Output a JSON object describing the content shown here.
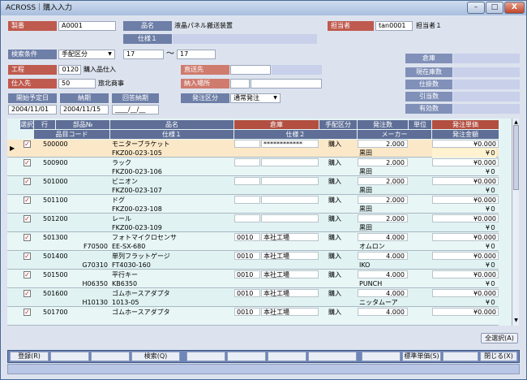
{
  "window": {
    "title": "ACROSS｜購入入力",
    "min": "–",
    "max": "□",
    "close": "X"
  },
  "header": {
    "seiban_label": "製番",
    "seiban_value": "A0001",
    "hinmei_label": "品名",
    "hinmei_value": "液晶パネル搬送装置",
    "shiyo1_label": "仕様１",
    "tanto_label": "担当者",
    "tanto_code": "tan0001",
    "tanto_name": "担当者１",
    "kensaku_label": "検索条件",
    "kensaku_value": "手配区分",
    "range_from": "17",
    "range_sep": "～",
    "range_to": "17",
    "souko_label": "倉庫",
    "koutei_label": "工程",
    "koutei_code": "0120",
    "koutei_name": "購入品仕入",
    "chokusou_label": "直送先",
    "genzaiko_label": "現在庫数",
    "shiiresaki_label": "仕入先",
    "shiiresaki_code": "50",
    "shiiresaki_name": "旅北商事",
    "nounyu_label": "納入場所",
    "shiharai_label": "仕掛数",
    "start_label": "開始予定日",
    "start_value": "2004/11/01",
    "nouki_label": "納期",
    "nouki_value": "2004/11/15",
    "kaito_label": "回答納期",
    "kaito_value": "____/__/__",
    "hatchu_label": "発注区分",
    "hatchu_value": "通常発注",
    "hikiate_label": "引当数",
    "yuko_label": "有効数"
  },
  "grid": {
    "headers1": {
      "sentaku": "選択",
      "gyo": "行",
      "buhin": "部品№",
      "hinmei": "品名",
      "souko": "倉庫",
      "tehai": "手配区分",
      "hatchusu": "発注数",
      "tani": "単位",
      "tanka": "発注単価"
    },
    "headers2": {
      "code": "品目コード",
      "shiyo1": "仕様１",
      "shiyo2": "仕様２",
      "maker": "メーカー",
      "kingaku": "発注金額"
    },
    "rows": [
      {
        "code": "500000",
        "name": "モニターブラケット",
        "spec1": "FKZ00-023-105",
        "wh_code": "",
        "wh_name": "************",
        "kubun": "購入",
        "qty": "2.000",
        "maker": "黒田",
        "price": "¥0.000",
        "amount": "¥０",
        "checked": "✓",
        "part": "",
        "current": true
      },
      {
        "code": "500900",
        "name": "ラック",
        "spec1": "FKZ00-023-106",
        "wh_code": "",
        "wh_name": "",
        "kubun": "購入",
        "qty": "2.000",
        "maker": "黒田",
        "price": "¥0.000",
        "amount": "¥０",
        "checked": "✓",
        "part": ""
      },
      {
        "code": "501000",
        "name": "ビニオン",
        "spec1": "FKZ00-023-107",
        "wh_code": "",
        "wh_name": "",
        "kubun": "購入",
        "qty": "2.000",
        "maker": "黒田",
        "price": "¥0.000",
        "amount": "¥０",
        "checked": "✓",
        "part": ""
      },
      {
        "code": "501100",
        "name": "ドグ",
        "spec1": "FKZ00-023-108",
        "wh_code": "",
        "wh_name": "",
        "kubun": "購入",
        "qty": "2.000",
        "maker": "黒田",
        "price": "¥0.000",
        "amount": "¥０",
        "checked": "✓",
        "part": ""
      },
      {
        "code": "501200",
        "name": "レール",
        "spec1": "FKZ00-023-109",
        "wh_code": "",
        "wh_name": "",
        "kubun": "購入",
        "qty": "2.000",
        "maker": "黒田",
        "price": "¥0.000",
        "amount": "¥０",
        "checked": "✓",
        "part": ""
      },
      {
        "code": "501300",
        "name": "フォトマイクロセンサ",
        "spec1": "EE-SX-680",
        "wh_code": "0010",
        "wh_name": "本社工場",
        "kubun": "購入",
        "qty": "4.000",
        "maker": "オムロン",
        "price": "¥0.000",
        "amount": "¥０",
        "checked": "✓",
        "part": "F70500"
      },
      {
        "code": "501400",
        "name": "単列フラットゲージ",
        "spec1": "FT4030-160",
        "wh_code": "0010",
        "wh_name": "本社工場",
        "kubun": "購入",
        "qty": "4.000",
        "maker": "IKO",
        "price": "¥0.000",
        "amount": "¥０",
        "checked": "✓",
        "part": "G70310"
      },
      {
        "code": "501500",
        "name": "平行キー",
        "spec1": "KB6350",
        "wh_code": "0010",
        "wh_name": "本社工場",
        "kubun": "購入",
        "qty": "4.000",
        "maker": "PUNCH",
        "price": "¥0.000",
        "amount": "¥０",
        "checked": "✓",
        "part": "H06350"
      },
      {
        "code": "501600",
        "name": "ゴムホースアダプタ",
        "spec1": "1013-05",
        "wh_code": "0010",
        "wh_name": "本社工場",
        "kubun": "購入",
        "qty": "4.000",
        "maker": "ニッタムーア",
        "price": "¥0.000",
        "amount": "¥０",
        "checked": "✓",
        "part": "H10130"
      },
      {
        "code": "501700",
        "name": "ゴムホースアダプタ",
        "spec1": "",
        "wh_code": "0010",
        "wh_name": "本社工場",
        "kubun": "購入",
        "qty": "4.000",
        "maker": "",
        "price": "¥0.000",
        "amount": "",
        "checked": "✓",
        "part": ""
      }
    ]
  },
  "buttons": {
    "select_all": "全選択(A)"
  },
  "fkeys": {
    "touroku": "登録(R)",
    "kensaku": "検索(Q)",
    "hyojun": "標準単価(S)",
    "tojiru": "閉じる(X)"
  }
}
